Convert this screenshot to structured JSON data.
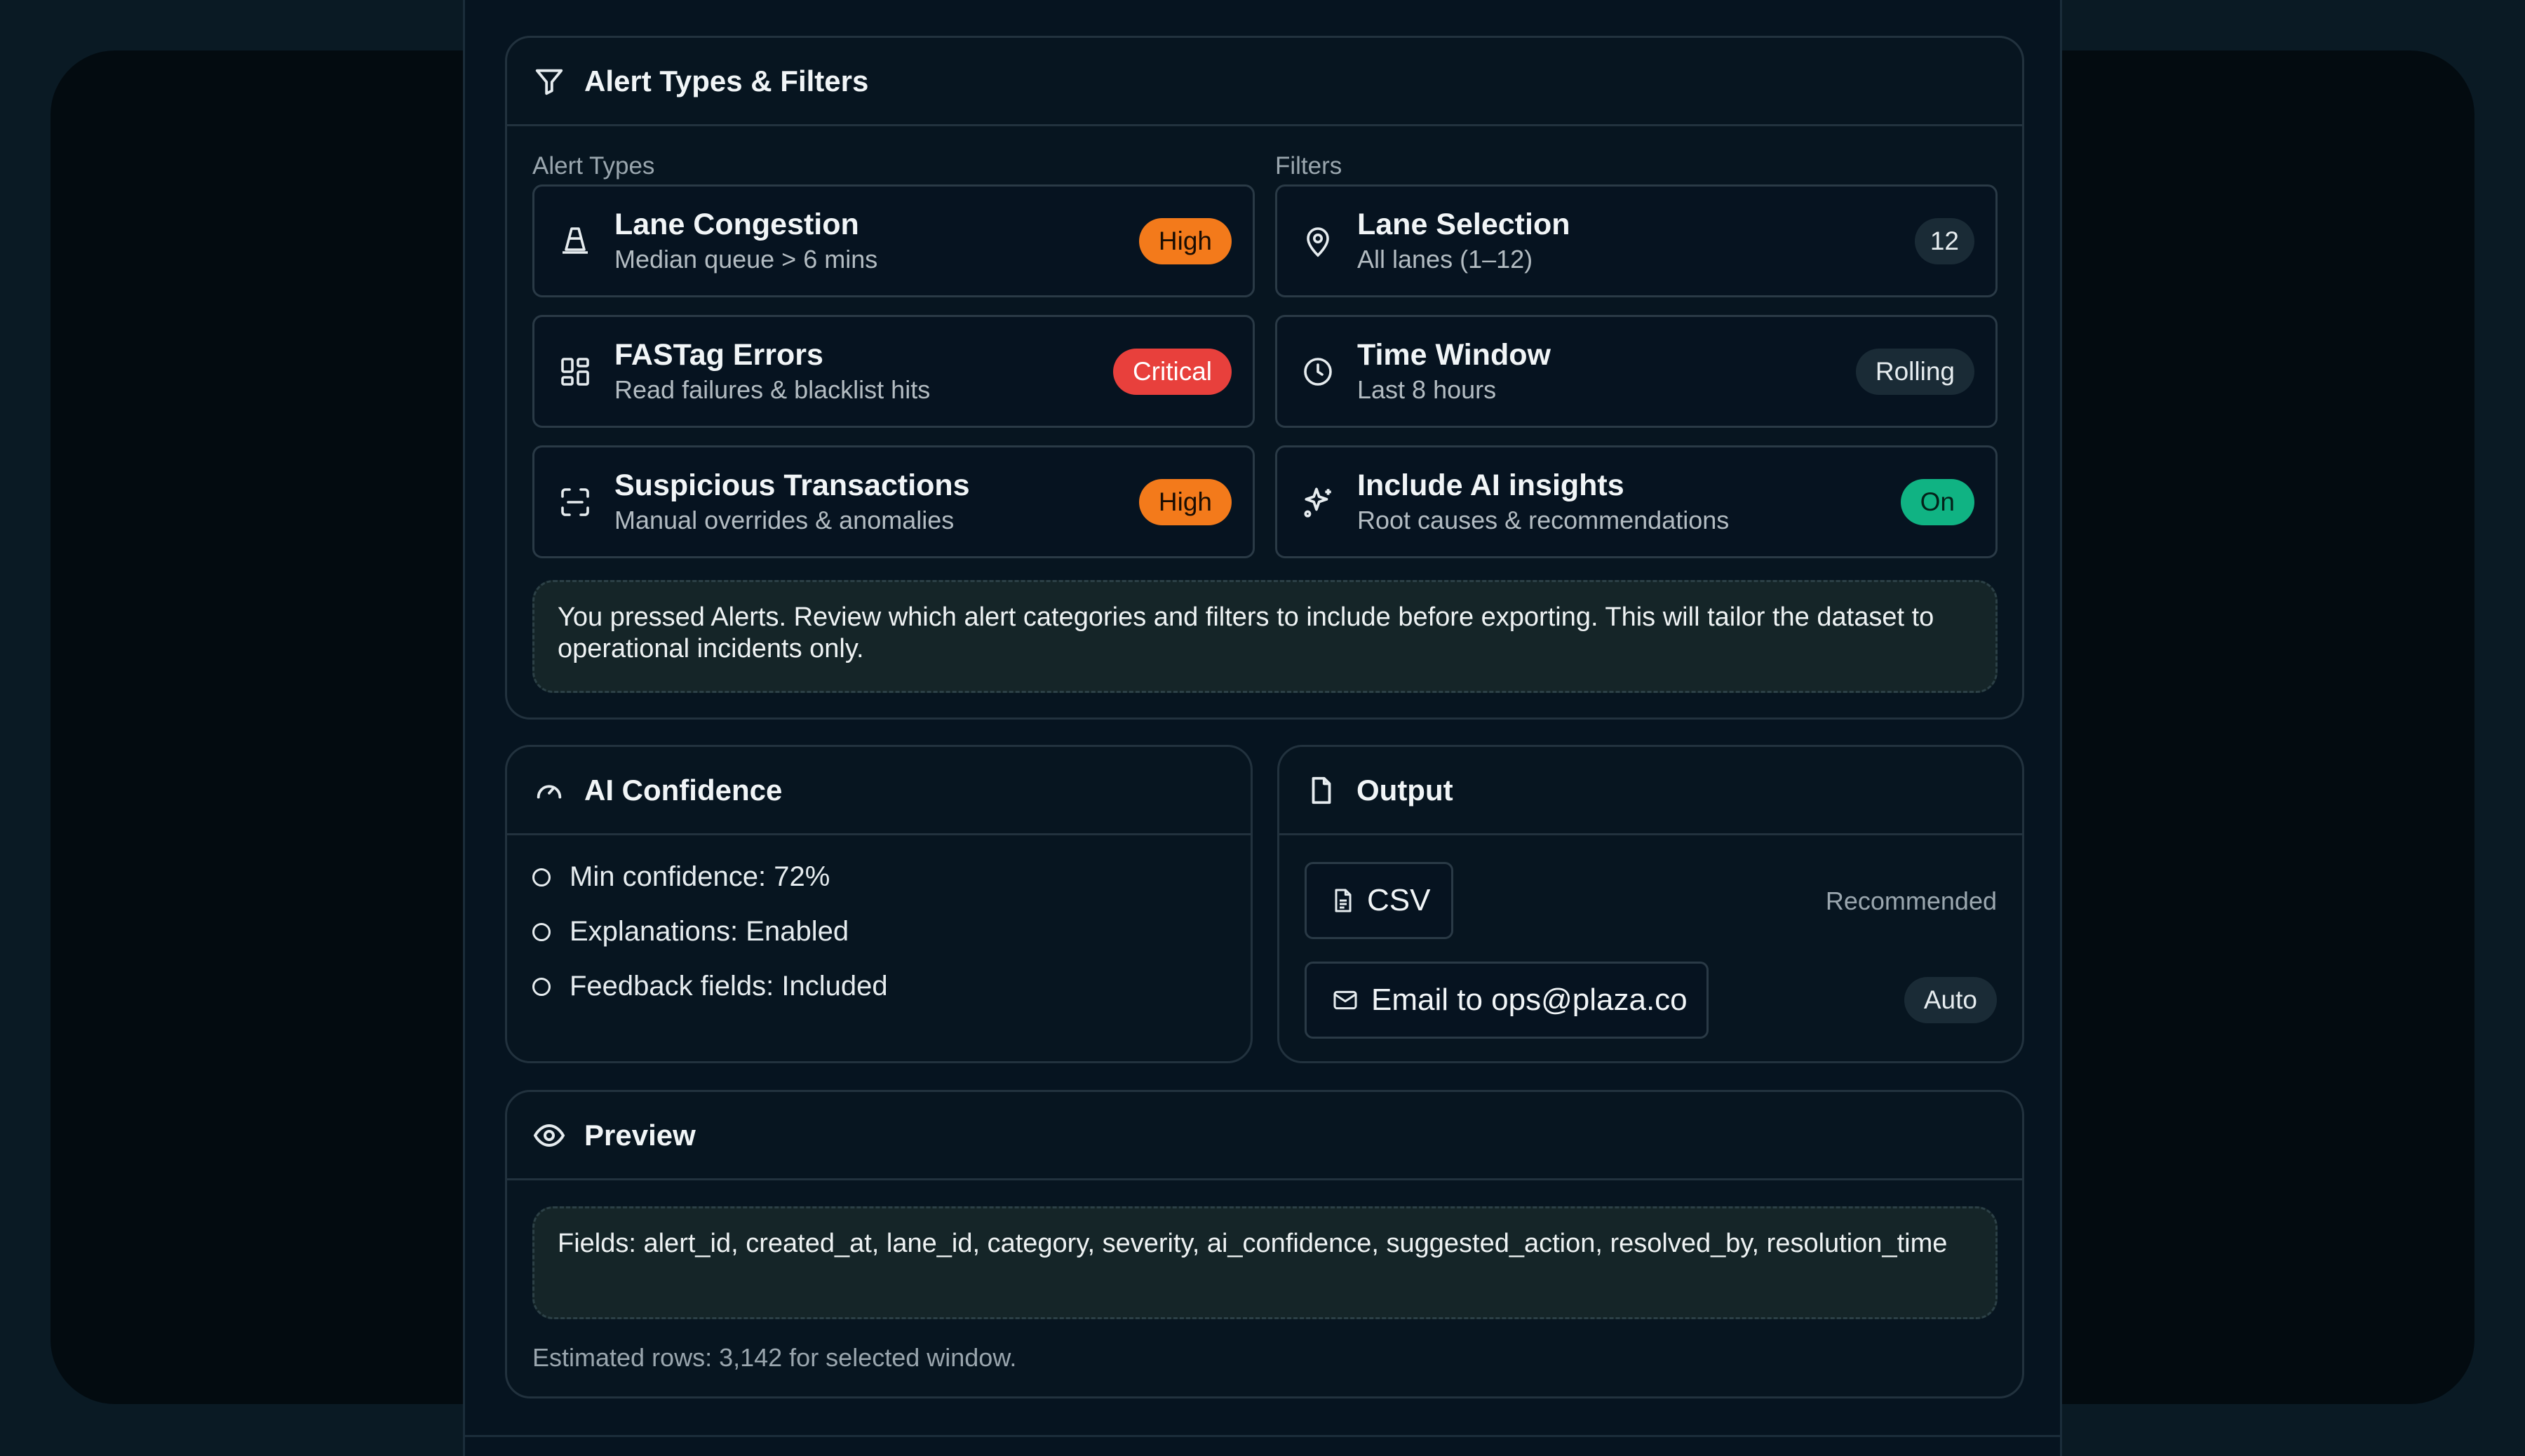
{
  "alert_card": {
    "title": "Alert Types & Filters",
    "alert_types_label": "Alert Types",
    "filters_label": "Filters",
    "alert_types": [
      {
        "title": "Lane Congestion",
        "subtitle": "Median queue > 6 mins",
        "badge": "High",
        "icon": "traffic-cone-icon"
      },
      {
        "title": "FASTag Errors",
        "subtitle": "Read failures & blacklist hits",
        "badge": "Critical",
        "icon": "grid-icon"
      },
      {
        "title": "Suspicious Transactions",
        "subtitle": "Manual overrides & anomalies",
        "badge": "High",
        "icon": "scan-icon"
      }
    ],
    "filters": [
      {
        "title": "Lane Selection",
        "subtitle": "All lanes (1–12)",
        "badge": "12",
        "icon": "map-pin-icon"
      },
      {
        "title": "Time Window",
        "subtitle": "Last 8 hours",
        "badge": "Rolling",
        "icon": "clock-icon"
      },
      {
        "title": "Include AI insights",
        "subtitle": "Root causes & recommendations",
        "badge": "On",
        "icon": "sparkles-icon"
      }
    ],
    "note": "You pressed Alerts. Review which alert categories and filters to include before exporting. This will tailor the dataset to operational incidents only."
  },
  "confidence_card": {
    "title": "AI Confidence",
    "items": [
      "Min confidence: 72%",
      "Explanations: Enabled",
      "Feedback fields: Included"
    ]
  },
  "output_card": {
    "title": "Output",
    "csv_label": "CSV",
    "csv_tag": "Recommended",
    "email_label": "Email to ops@plaza.co",
    "email_badge": "Auto"
  },
  "preview_card": {
    "title": "Preview",
    "fields": "Fields: alert_id, created_at, lane_id, category, severity, ai_confidence, suggested_action, resolved_by, resolution_time",
    "estimate": "Estimated rows: 3,142 for selected window."
  },
  "colors": {
    "high": "#f37a1b",
    "critical": "#e8403c",
    "on": "#10b383",
    "background": "#061420"
  }
}
